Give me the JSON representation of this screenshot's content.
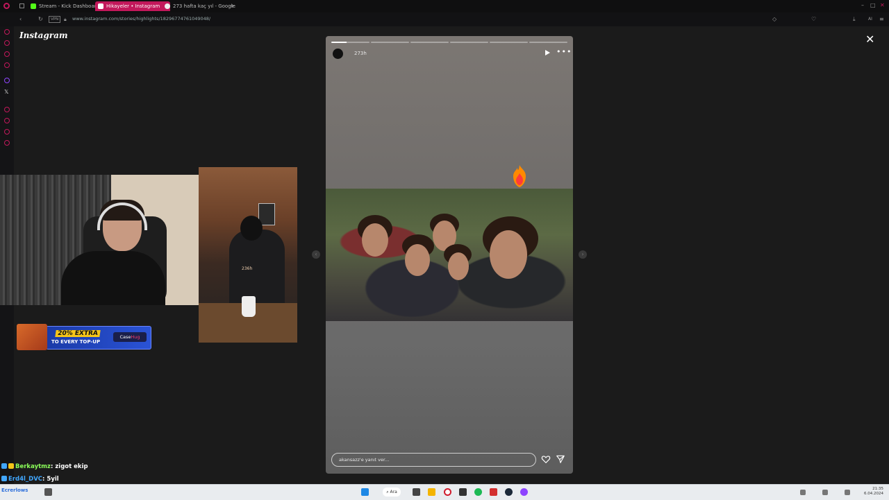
{
  "browser": {
    "tabs": [
      {
        "label": "Stream - Kick Dashboard",
        "icon": "kick-icon",
        "color": "#53fc18"
      },
      {
        "label": "Hikayeler • Instagram",
        "icon": "instagram-icon",
        "color": "#e1306c",
        "active": true
      },
      {
        "label": "273 hafta kaç yıl - Google",
        "icon": "google-icon",
        "color": "#ffffff"
      }
    ],
    "url": "www.instagram.com/stories/highlights/18296774761049048/",
    "vpn_label": "VPN",
    "profile_label": "AI"
  },
  "instagram": {
    "logo": "Instagram",
    "story": {
      "time_ago": "273h",
      "reply_placeholder": "akansazz'e yanıt ver...",
      "progress_segments": 6,
      "progress_current": 0
    }
  },
  "stream_overlay": {
    "cam_label": "236h",
    "ad": {
      "line1": "20% EXTRA",
      "line2": "TO EVERY TOP-UP",
      "brand_a": "Case",
      "brand_b": "Hug"
    },
    "chat": [
      {
        "user": "Berkaytmz",
        "message": ": zigot ekip"
      },
      {
        "user": "Erd4l_DVC",
        "message": ": 5yil"
      }
    ]
  },
  "taskbar": {
    "search_label": "Ara",
    "time": "21:35",
    "date": "6.04.2024",
    "user_label": "Ecrerlows"
  },
  "colors": {
    "accent": "#c2185b",
    "chat_user": "#8cff5a",
    "chat_user2": "#41a7ff"
  }
}
